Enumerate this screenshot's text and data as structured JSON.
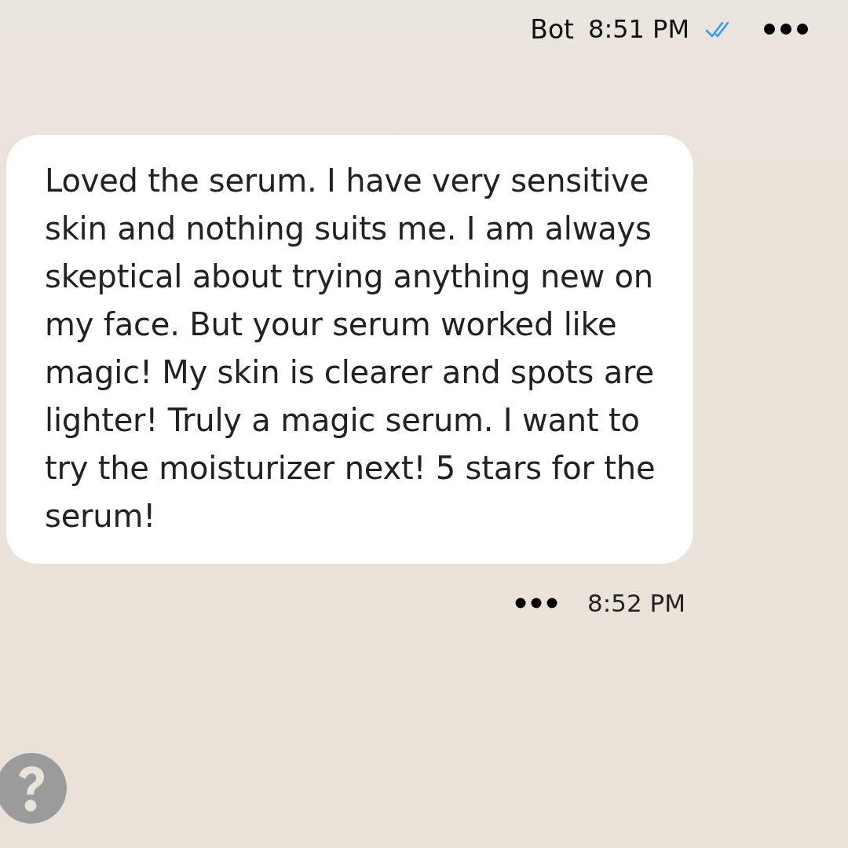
{
  "header": {
    "sender": "Bot",
    "time": "8:51 PM",
    "read": true
  },
  "message": {
    "text": "Loved the serum. I have very sensitive skin and nothing suits me. I am always skeptical about trying anything new on my face. But your serum worked like magic! My skin is clearer and spots are lighter! Truly a magic serum. I want to try the moisturizer next! 5 stars for the serum!",
    "time": "8:52 PM"
  }
}
